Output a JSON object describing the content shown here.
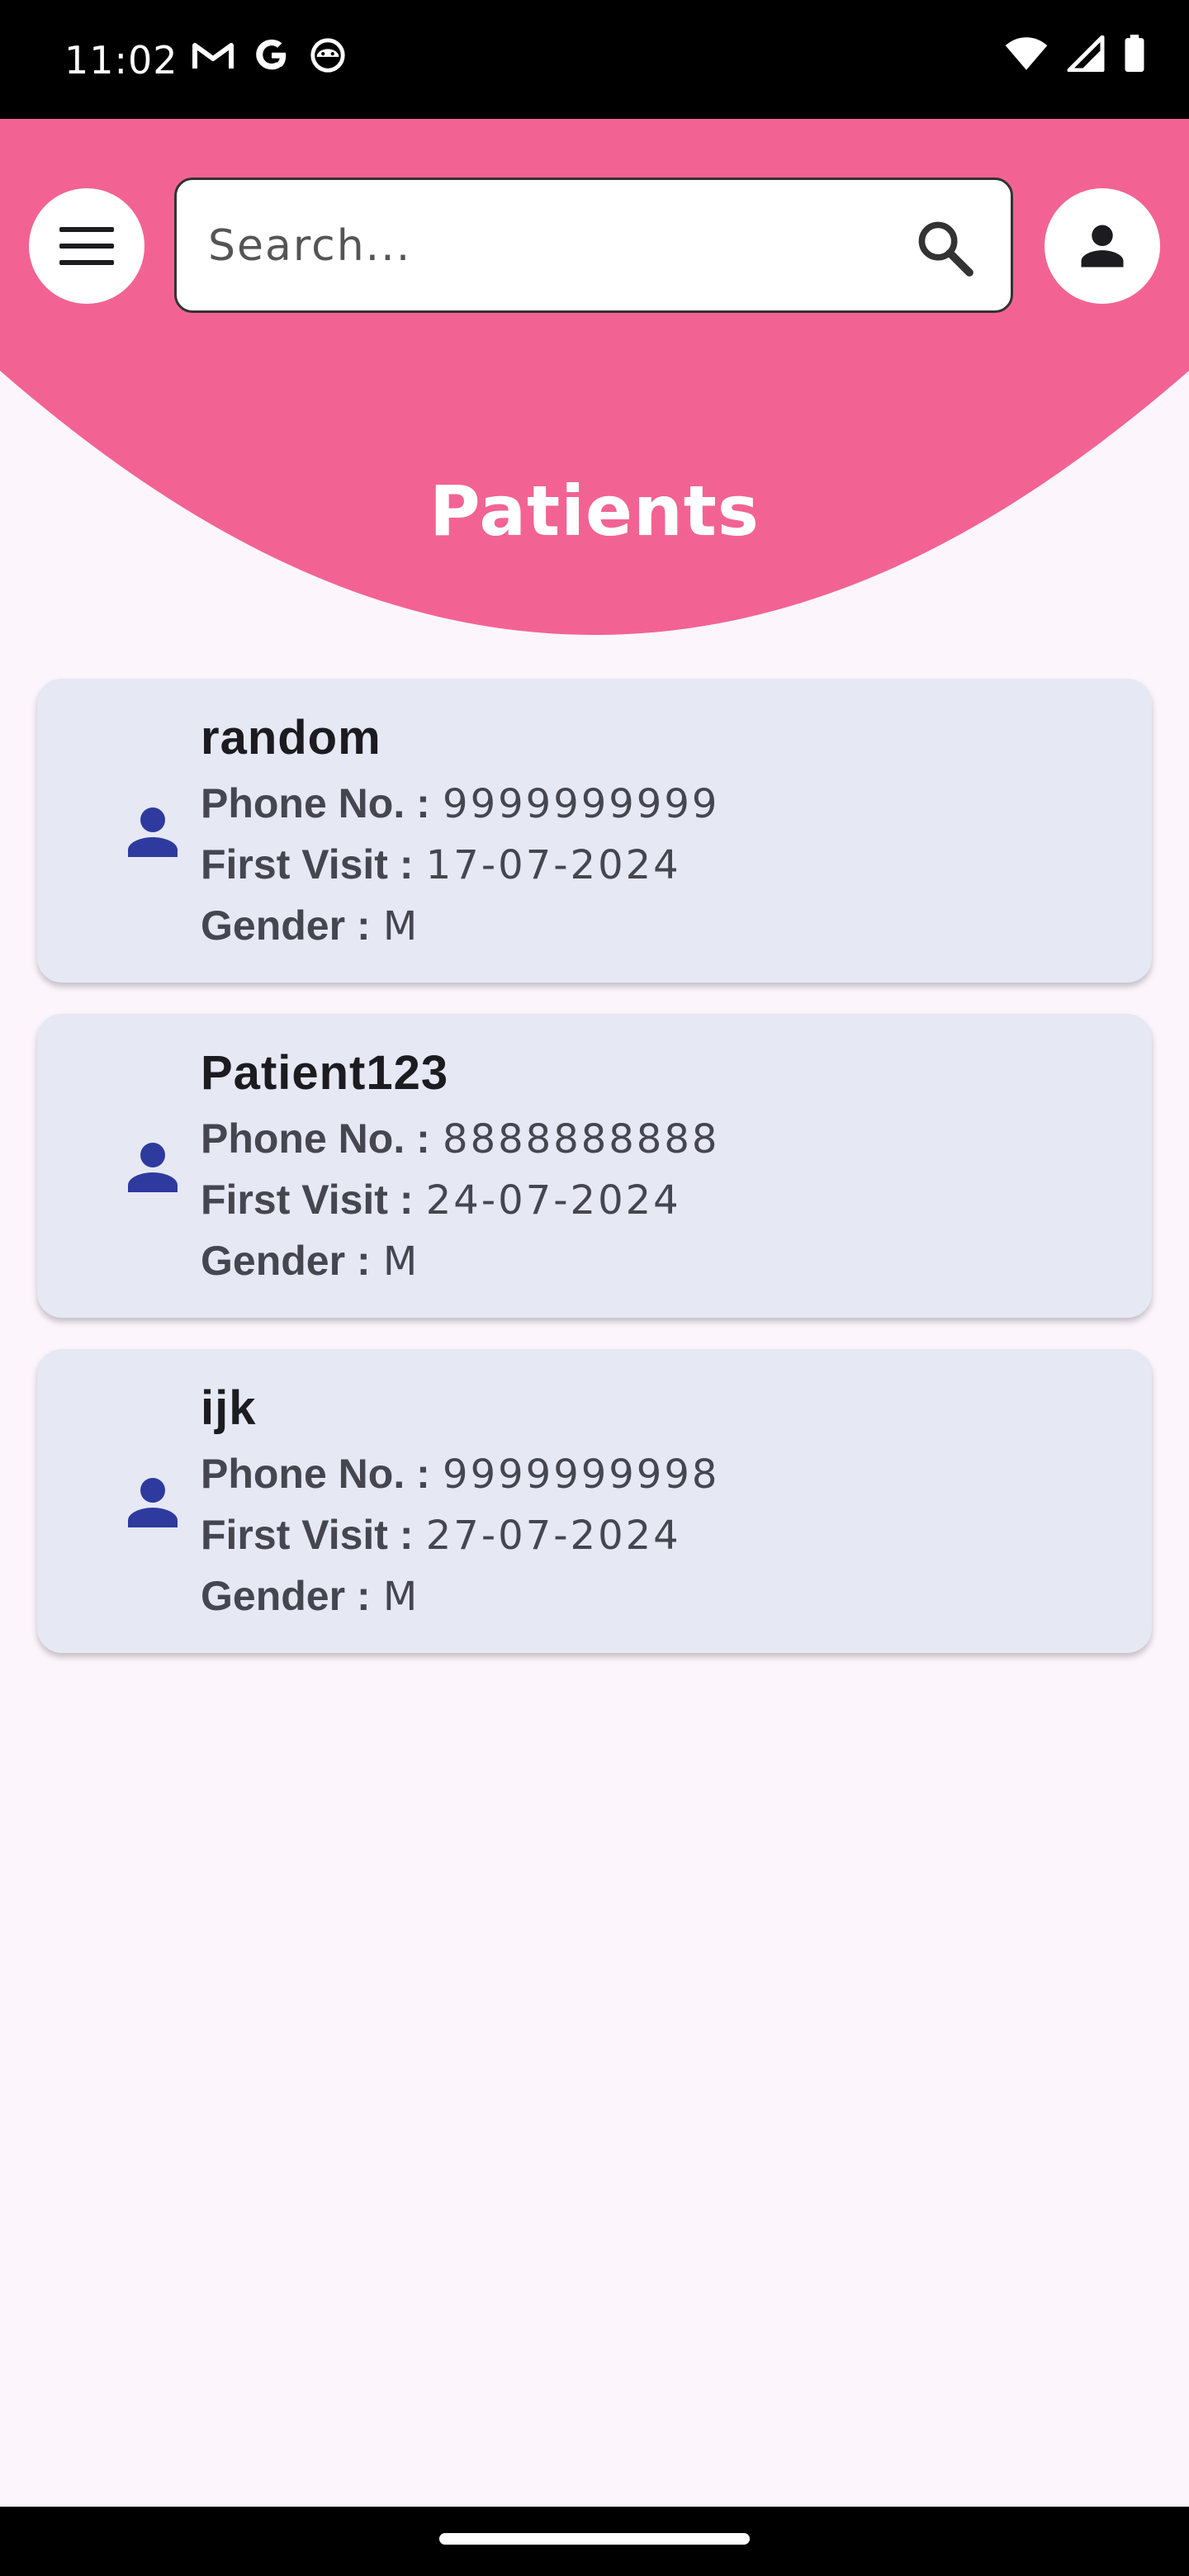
{
  "status_bar": {
    "time": "11:02",
    "left_icons": [
      "gmail-icon",
      "google-icon",
      "android-icon"
    ],
    "right_icons": [
      "wifi-icon",
      "signal-icon",
      "battery-icon"
    ]
  },
  "header": {
    "color": "#f26393",
    "search": {
      "placeholder": "Search..."
    },
    "menu_icon": "hamburger-menu-icon",
    "profile_icon": "person-icon",
    "title": "Patients"
  },
  "patients": [
    {
      "name": "random",
      "phone_label": "Phone No. :",
      "phone": "9999999999",
      "visit_label": "First Visit :",
      "first_visit": "17-07-2024",
      "gender_label": "Gender :",
      "gender": "M"
    },
    {
      "name": "Patient123",
      "phone_label": "Phone No. :",
      "phone": "8888888888",
      "visit_label": "First Visit :",
      "first_visit": "24-07-2024",
      "gender_label": "Gender :",
      "gender": "M"
    },
    {
      "name": "ijk",
      "phone_label": "Phone No. :",
      "phone": "9999999998",
      "visit_label": "First Visit :",
      "first_visit": "27-07-2024",
      "gender_label": "Gender :",
      "gender": "M"
    }
  ],
  "colors": {
    "accent": "#f26393",
    "card_bg": "#e6e8f4",
    "icon_blue": "#2e3a9e",
    "page_bg": "#fcf5fc"
  }
}
